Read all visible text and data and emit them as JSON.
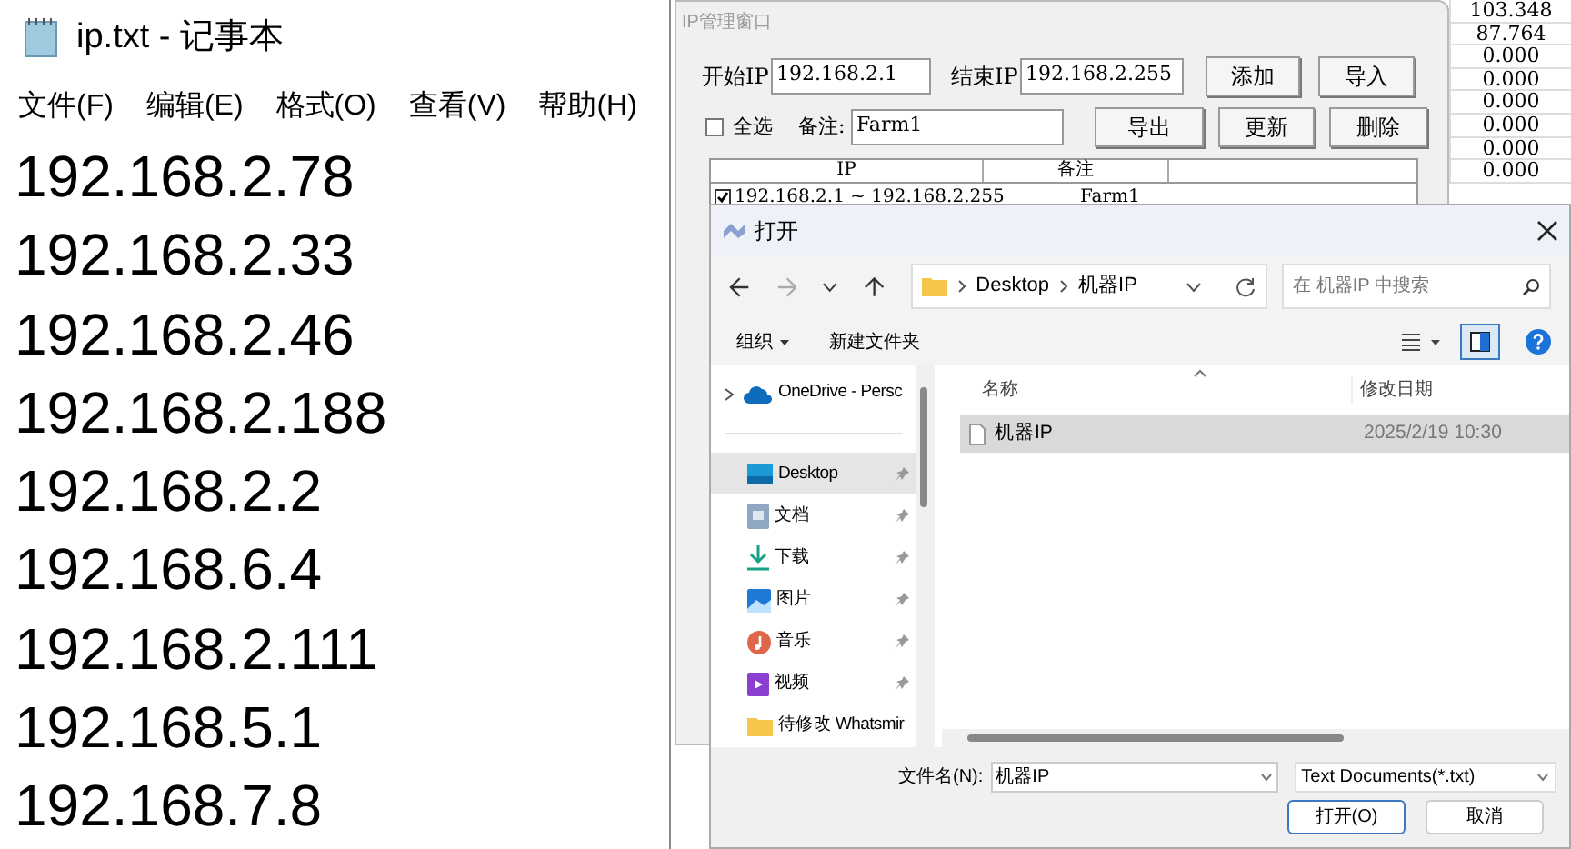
{
  "notepad": {
    "title": "ip.txt - 记事本",
    "menu": [
      "文件(F)",
      "编辑(E)",
      "格式(O)",
      "查看(V)",
      "帮助(H)"
    ],
    "lines": [
      "192.168.2.78",
      "192.168.2.33",
      "192.168.2.46",
      "192.168.2.188",
      "192.168.2.2",
      "192.168.6.4",
      "192.168.2.111",
      "192.168.5.1",
      "192.168.7.8"
    ]
  },
  "ip_window": {
    "title": "IP管理窗口",
    "start_label": "开始IP",
    "start_ip": "192.168.2.1",
    "end_label": "结束IP",
    "end_ip": "192.168.2.255",
    "buttons_row1": [
      "添加",
      "导入"
    ],
    "select_all": {
      "label": "全选",
      "checked": false
    },
    "note_label": "备注:",
    "note_value": "Farm1",
    "buttons_row2": [
      "导出",
      "更新",
      "删除"
    ],
    "table": {
      "columns": [
        "IP",
        "备注"
      ],
      "rows": [
        {
          "checked": true,
          "range": "192.168.2.1 ~ 192.168.2.255",
          "note": "Farm1"
        }
      ]
    }
  },
  "sheet_column": [
    "103.348",
    "87.764",
    "0.000",
    "0.000",
    "0.000",
    "0.000",
    "0.000",
    "0.000"
  ],
  "open_dialog": {
    "title": "打开",
    "path": [
      "Desktop",
      "机器IP"
    ],
    "search_placeholder": "在 机器IP 中搜索",
    "organize": "组织",
    "new_folder": "新建文件夹",
    "sidebar": [
      {
        "kind": "onedrive",
        "label": "OneDrive - Persc",
        "pinned": false,
        "selected": false
      },
      {
        "kind": "desktop",
        "label": "Desktop",
        "pinned": true,
        "selected": true
      },
      {
        "kind": "documents",
        "label": "文档",
        "pinned": true,
        "selected": false
      },
      {
        "kind": "downloads",
        "label": "下载",
        "pinned": true,
        "selected": false
      },
      {
        "kind": "pictures",
        "label": "图片",
        "pinned": true,
        "selected": false
      },
      {
        "kind": "music",
        "label": "音乐",
        "pinned": true,
        "selected": false
      },
      {
        "kind": "videos",
        "label": "视频",
        "pinned": true,
        "selected": false
      },
      {
        "kind": "folder",
        "label": "待修改 Whatsmir",
        "pinned": false,
        "selected": false
      }
    ],
    "columns": [
      "名称",
      "修改日期"
    ],
    "files": [
      {
        "name": "机器IP",
        "date": "2025/2/19 10:30",
        "selected": true
      }
    ],
    "filename_label": "文件名(N):",
    "filename": "机器IP",
    "file_type": "Text Documents(*.txt)",
    "buttons": [
      {
        "label": "打开(O)",
        "primary": true
      },
      {
        "label": "取消",
        "primary": false
      }
    ]
  }
}
